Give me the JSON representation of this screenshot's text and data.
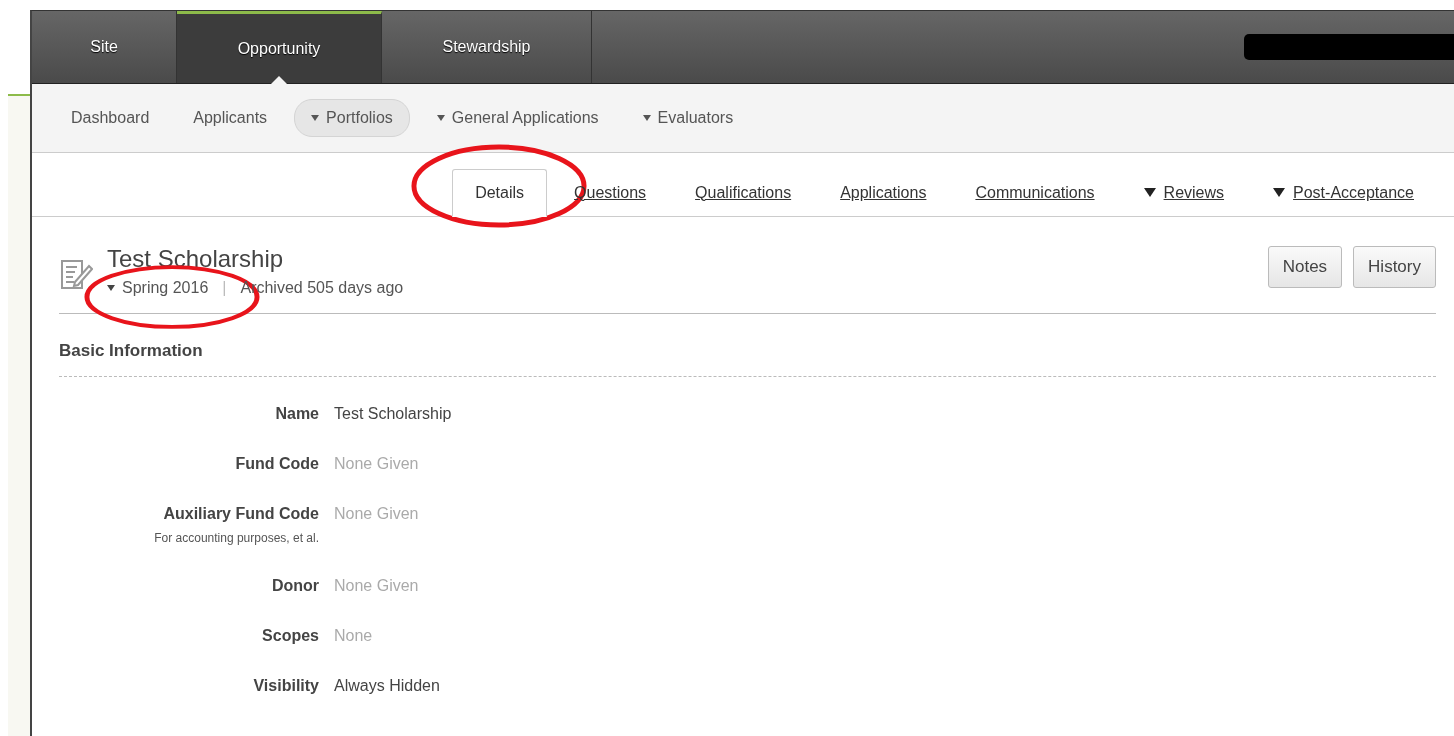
{
  "main_nav": [
    {
      "label": "Site",
      "selected": false
    },
    {
      "label": "Opportunity",
      "selected": true
    },
    {
      "label": "Stewardship",
      "selected": false
    }
  ],
  "sub_nav": [
    {
      "label": "Dashboard",
      "dropdown": false,
      "selected": false
    },
    {
      "label": "Applicants",
      "dropdown": false,
      "selected": false
    },
    {
      "label": "Portfolios",
      "dropdown": true,
      "selected": true
    },
    {
      "label": "General Applications",
      "dropdown": true,
      "selected": false
    },
    {
      "label": "Evaluators",
      "dropdown": true,
      "selected": false
    }
  ],
  "page_tabs": [
    {
      "label": "Details",
      "selected": true,
      "dropdown": false,
      "circled": true
    },
    {
      "label": "Questions",
      "selected": false,
      "dropdown": false,
      "circled": false
    },
    {
      "label": "Qualifications",
      "selected": false,
      "dropdown": false,
      "circled": false
    },
    {
      "label": "Applications",
      "selected": false,
      "dropdown": false,
      "circled": false
    },
    {
      "label": "Communications",
      "selected": false,
      "dropdown": false,
      "circled": false
    },
    {
      "label": "Reviews",
      "selected": false,
      "dropdown": true,
      "circled": false
    },
    {
      "label": "Post-Acceptance",
      "selected": false,
      "dropdown": true,
      "circled": false
    }
  ],
  "record": {
    "title": "Test Scholarship",
    "term": "Spring 2016",
    "term_circled": true,
    "separator": "|",
    "status": "Archived 505 days ago",
    "buttons": [
      "Notes",
      "History"
    ]
  },
  "section": {
    "title": "Basic Information",
    "fields": [
      {
        "label": "Name",
        "value": "Test Scholarship",
        "empty": false
      },
      {
        "label": "Fund Code",
        "value": "None Given",
        "empty": true
      },
      {
        "label": "Auxiliary Fund Code",
        "hint": "For accounting purposes, et al.",
        "value": "None Given",
        "empty": true
      },
      {
        "label": "Donor",
        "value": "None Given",
        "empty": true
      },
      {
        "label": "Scopes",
        "value": "None",
        "empty": true
      },
      {
        "label": "Visibility",
        "value": "Always Hidden",
        "empty": false
      }
    ]
  }
}
